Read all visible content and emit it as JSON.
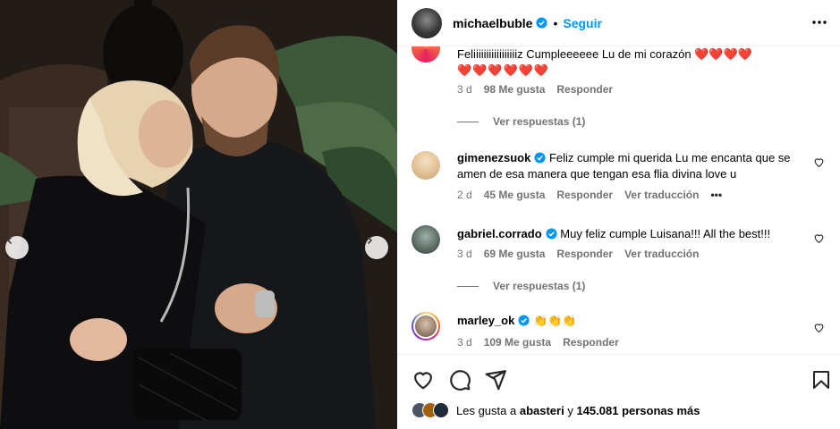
{
  "header": {
    "username": "michaelbuble",
    "separator": "•",
    "follow_label": "Seguir"
  },
  "comments": [
    {
      "username": "",
      "text": "Feliiiiiiiiiiiiiiiiiz Cumpleeeeee Lu de mi corazón ❤️❤️❤️❤️",
      "text2": "❤️❤️❤️❤️❤️❤️",
      "time": "3 d",
      "likes": "98 Me gusta",
      "reply": "Responder",
      "replies_label": "Ver respuestas (1)"
    },
    {
      "username": "gimenezsuok",
      "text": "Feliz cumple mi querida Lu me encanta que se amen de esa manera que tengan esa flia divina love u",
      "time": "2 d",
      "likes": "45 Me gusta",
      "reply": "Responder",
      "translate": "Ver traducción",
      "more": "•••"
    },
    {
      "username": "gabriel.corrado",
      "text": "Muy feliz cumple Luisana!!! All the best!!!",
      "time": "3 d",
      "likes": "69 Me gusta",
      "reply": "Responder",
      "translate": "Ver traducción",
      "replies_label": "Ver respuestas (1)"
    },
    {
      "username": "marley_ok",
      "text": "👏👏👏",
      "time": "3 d",
      "likes": "109 Me gusta",
      "reply": "Responder"
    }
  ],
  "likes_line": {
    "prefix": "Les gusta a",
    "user": "abasteri",
    "connector": "y",
    "count": "145.081 personas más"
  },
  "colors": {
    "accent": "#0095f6",
    "muted": "#737373",
    "verified": "#0095f6"
  },
  "icons": [
    "chevron-left-icon",
    "chevron-right-icon",
    "verified-icon",
    "more-icon",
    "heart-icon",
    "comment-icon",
    "share-icon",
    "bookmark-icon"
  ]
}
